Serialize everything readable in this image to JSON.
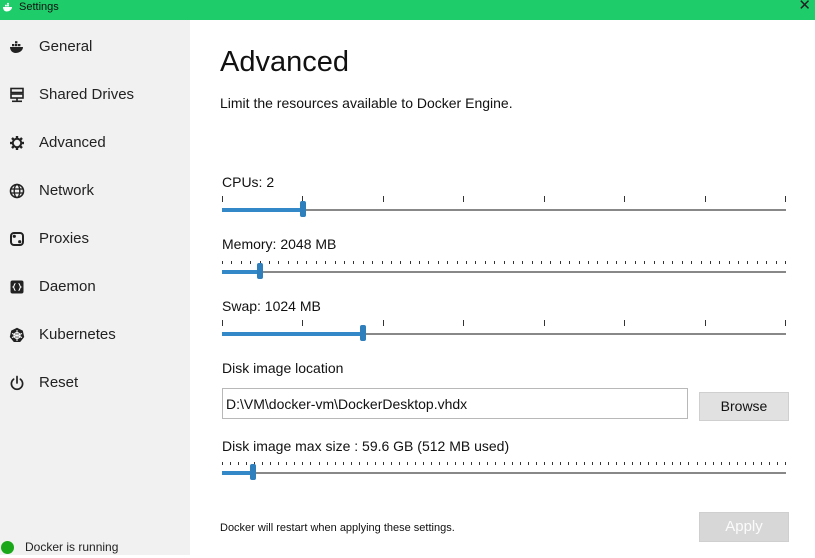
{
  "window": {
    "title": "Settings",
    "close_symbol": "✕"
  },
  "sidebar": {
    "items": [
      {
        "label": "General",
        "icon": "whale-icon"
      },
      {
        "label": "Shared Drives",
        "icon": "drives-icon"
      },
      {
        "label": "Advanced",
        "icon": "gear-icon"
      },
      {
        "label": "Network",
        "icon": "globe-icon"
      },
      {
        "label": "Proxies",
        "icon": "proxy-icon"
      },
      {
        "label": "Daemon",
        "icon": "braces-icon"
      },
      {
        "label": "Kubernetes",
        "icon": "helm-icon"
      },
      {
        "label": "Reset",
        "icon": "power-icon"
      }
    ],
    "status": {
      "text": "Docker is running",
      "color": "#1aa81a"
    }
  },
  "main": {
    "title": "Advanced",
    "subtitle": "Limit the resources available to Docker Engine.",
    "cpus": {
      "label": "CPUs: 2",
      "value": 2,
      "min": 1,
      "max": 8
    },
    "memory": {
      "label": "Memory: 2048 MB",
      "value": 2048,
      "min": 1024,
      "max": 16384
    },
    "swap": {
      "label": "Swap: 1024 MB",
      "value": 1024,
      "min": 0,
      "max": 4096
    },
    "disk_location": {
      "label": "Disk image location",
      "value": "D:\\VM\\docker-vm\\DockerDesktop.vhdx",
      "browse_label": "Browse"
    },
    "disk_size": {
      "label": "Disk image max size : 59.6 GB (512 MB  used)",
      "fraction": 0.055
    },
    "footer_note": "Docker will restart when applying these settings.",
    "apply_label": "Apply"
  },
  "colors": {
    "titlebar": "#1ecc6a",
    "sidebar_bg": "#f1f1f1",
    "slider_accent": "#2f7fbd"
  }
}
